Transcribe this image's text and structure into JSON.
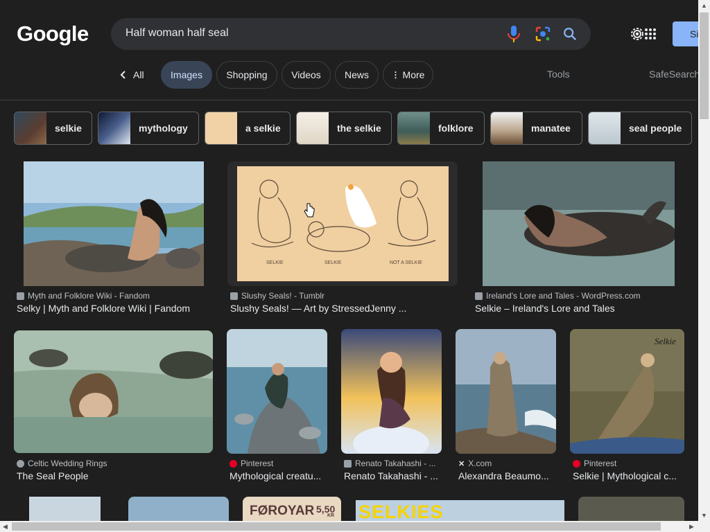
{
  "header": {
    "logo": "Google",
    "query": "Half woman half seal",
    "signin_label": "Si"
  },
  "tabs": {
    "back_label": "All",
    "items": [
      {
        "label": "Images",
        "active": true
      },
      {
        "label": "Shopping"
      },
      {
        "label": "Videos"
      },
      {
        "label": "News"
      },
      {
        "label": "More"
      }
    ],
    "tools_label": "Tools",
    "safesearch_label": "SafeSearch"
  },
  "chips": [
    {
      "label": "selkie"
    },
    {
      "label": "mythology"
    },
    {
      "label": "a selkie"
    },
    {
      "label": "the selkie"
    },
    {
      "label": "folklore"
    },
    {
      "label": "manatee"
    },
    {
      "label": "seal people"
    }
  ],
  "results": [
    {
      "source": "Myth and Folklore Wiki - Fandom",
      "title": "Selky | Myth and Folklore Wiki | Fandom"
    },
    {
      "source": "Slushy Seals! - Tumblr",
      "title": "Slushy Seals! — Art by StressedJenny ..."
    },
    {
      "source": "Ireland's Lore and Tales - WordPress.com",
      "title": "Selkie – Ireland's Lore and Tales"
    },
    {
      "source": "Celtic Wedding Rings",
      "title": "The Seal People"
    },
    {
      "source": "Pinterest",
      "title": "Mythological creatu..."
    },
    {
      "source": "Renato Takahashi - ...",
      "title": "Renato Takahashi - ..."
    },
    {
      "source": "X.com",
      "title": "Alexandra Beaumo..."
    },
    {
      "source": "Pinterest",
      "title": "Selkie | Mythological c..."
    }
  ],
  "partial_row": {
    "stamp_text": "FØROYAR",
    "stamp_value": "5,50",
    "stamp_currency": "KR",
    "poster_text": "SELKIES"
  },
  "image_labels": {
    "sketch_label_1": "SELKIE",
    "sketch_label_2": "SELKIE",
    "sketch_label_3": "NOT A SELKIE",
    "painting_signature": "Selkie"
  },
  "colors": {
    "background": "#1f1f1f",
    "accent": "#8ab4f8",
    "active_tab": "#394457",
    "pinterest": "#e60023"
  },
  "icons": {
    "mic": "mic-icon",
    "lens": "lens-icon",
    "search": "search-icon",
    "settings": "gear-icon",
    "apps": "apps-grid-icon",
    "back": "chevron-left-icon",
    "more": "more-vert-icon"
  }
}
